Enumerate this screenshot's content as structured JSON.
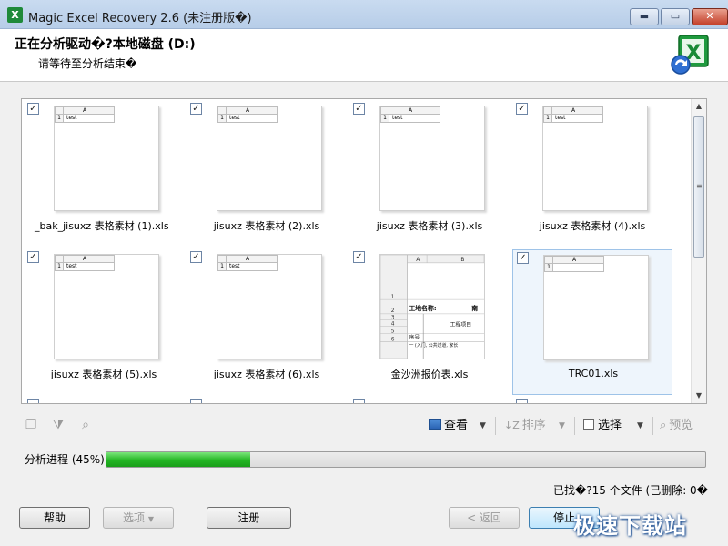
{
  "window": {
    "title": "Magic Excel Recovery 2.6 (未注册版�)",
    "icon_label": "X",
    "controls": [
      "minimize-icon",
      "maximize-icon",
      "close-icon"
    ]
  },
  "header": {
    "title": "正在分析驱动�?本地磁盘 (D:)",
    "subtitle": "请等待至分析结束�",
    "logo": "excel-recovery-logo"
  },
  "thumbnails": [
    {
      "name": "_bak_jisuxz 表格素材 (1).xls",
      "checked": true,
      "selected": false,
      "col_header": "A",
      "row": "1",
      "cell": "test",
      "kind": "mini"
    },
    {
      "name": "jisuxz 表格素材 (2).xls",
      "checked": true,
      "selected": false,
      "col_header": "A",
      "row": "1",
      "cell": "test",
      "kind": "mini"
    },
    {
      "name": "jisuxz 表格素材 (3).xls",
      "checked": true,
      "selected": false,
      "col_header": "A",
      "row": "1",
      "cell": "test",
      "kind": "mini"
    },
    {
      "name": "jisuxz 表格素材 (4).xls",
      "checked": true,
      "selected": false,
      "col_header": "A",
      "row": "1",
      "cell": "test",
      "kind": "mini"
    },
    {
      "name": "jisuxz 表格素材 (5).xls",
      "checked": true,
      "selected": false,
      "col_header": "A",
      "row": "1",
      "cell": "test",
      "kind": "mini"
    },
    {
      "name": "jisuxz 表格素材 (6).xls",
      "checked": true,
      "selected": false,
      "col_header": "A",
      "row": "1",
      "cell": "test",
      "kind": "mini"
    },
    {
      "name": "金沙洲报价表.xls",
      "checked": true,
      "selected": false,
      "kind": "sheet"
    },
    {
      "name": "TRC01.xls",
      "checked": true,
      "selected": true,
      "col_header": "A",
      "row": "1",
      "cell": "",
      "kind": "mini"
    }
  ],
  "sheet_preview": {
    "col_a": "A",
    "col_b": "B",
    "rows": [
      "1",
      "2",
      "3",
      "4",
      "5",
      "6"
    ],
    "site_label": "工地名称:",
    "site_value": "南",
    "project": "工程项目",
    "seq": "序号",
    "item": "一 (入门, 公共过道, 家长"
  },
  "toolbar": {
    "view_label": "查看",
    "sort_label": "排序",
    "select_label": "选择",
    "preview_label": "预览"
  },
  "progress": {
    "label": "分析进程 (45%)",
    "value": 0.24
  },
  "found_text": "已找�?15 个文件 (已删除: 0�",
  "buttons": {
    "help": "帮助",
    "options": "选项",
    "register": "注册",
    "back": "< 返回",
    "stop": "停止"
  },
  "watermark": "极速下载站",
  "colors": {
    "progress": "#24b624",
    "selected_bg": "#eef5fc",
    "titlebar": "#c9dbf0"
  }
}
